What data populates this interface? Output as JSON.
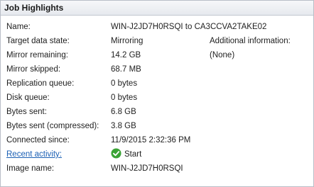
{
  "panel": {
    "title": "Job Highlights"
  },
  "rows": [
    {
      "label": "Name:",
      "value": "WIN-J2JD7H0RSQI to CA3CCVA2TAKE02"
    },
    {
      "label": "Target data state:",
      "value": "Mirroring",
      "extra": "Additional information:"
    },
    {
      "label": "Mirror remaining:",
      "value": "14.2 GB",
      "extra": "(None)"
    },
    {
      "label": "Mirror skipped:",
      "value": "68.7 MB"
    },
    {
      "label": "Replication queue:",
      "value": "0 bytes"
    },
    {
      "label": "Disk queue:",
      "value": "0 bytes"
    },
    {
      "label": "Bytes sent:",
      "value": "6.8 GB"
    },
    {
      "label": "Bytes sent (compressed):",
      "value": "3.8 GB"
    },
    {
      "label": "Connected since:",
      "value": "11/9/2015 2:32:36 PM"
    },
    {
      "label": "Recent activity:",
      "value": "Start",
      "icon": "green-check-icon"
    },
    {
      "label": "Image name:",
      "value": "WIN-J2JD7H0RSQI"
    }
  ],
  "colors": {
    "link": "#1a5fb4",
    "check": "#3aa335"
  }
}
